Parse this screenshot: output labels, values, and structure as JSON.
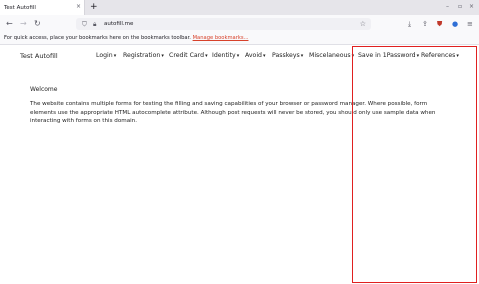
{
  "browser": {
    "tab_title": "Test Autofill",
    "tab_close": "×",
    "new_tab": "+",
    "url": "autofill.me",
    "bookmarks_text": "For quick access, place your bookmarks here on the bookmarks toolbar.",
    "bookmarks_link": "Manage bookmarks...",
    "window_controls": [
      "–",
      "▫",
      "×"
    ]
  },
  "site": {
    "title": "Test Autofill",
    "menu": [
      {
        "label": "Login"
      },
      {
        "label": "Registration"
      },
      {
        "label": "Credit Card"
      },
      {
        "label": "Identity"
      },
      {
        "label": "Avoid"
      },
      {
        "label": "Passkeys"
      },
      {
        "label": "Miscelaneous"
      },
      {
        "label": "Save in 1Password"
      },
      {
        "label": "References"
      }
    ],
    "caret": "▾"
  },
  "content": {
    "heading": "Welcome",
    "description": "The website contains multiple forms for testing the filling and saving capabilities of your browser or password manager. Where possible, form elements use the appropriate HTML autocomplete attribute. Although post requests will never be stored, you should only use sample data when interacting with forms on this domain."
  },
  "colors": {
    "highlight": "#e02020",
    "bookmark_link": "#d7412a"
  }
}
